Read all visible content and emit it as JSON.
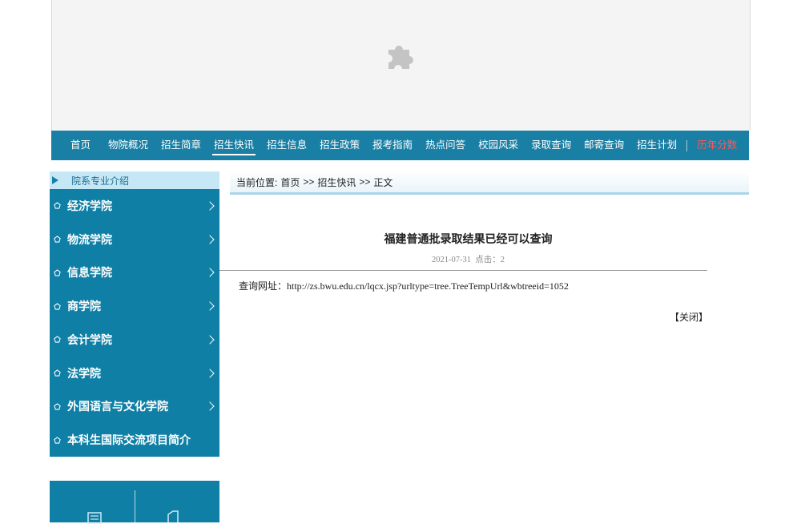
{
  "nav": {
    "items": [
      "首页",
      "物院概况",
      "招生简章",
      "招生快讯",
      "招生信息",
      "招生政策",
      "报考指南",
      "热点问答",
      "校园风采",
      "录取查询",
      "邮寄查询",
      "招生计划"
    ],
    "active_index": 3,
    "extra": "历年分数",
    "colors": {
      "bar": "#1a7fa4",
      "extra_text": "#ff5a5a"
    }
  },
  "sidebar": {
    "heading": "院系专业介绍",
    "items": [
      {
        "label": "经济学院"
      },
      {
        "label": "物流学院"
      },
      {
        "label": "信息学院"
      },
      {
        "label": "商学院"
      },
      {
        "label": "会计学院"
      },
      {
        "label": "法学院"
      },
      {
        "label": "外国语言与文化学院"
      },
      {
        "label": "本科生国际交流项目简介"
      }
    ]
  },
  "breadcrumb": {
    "prefix": "当前位置:",
    "items": [
      "首页",
      "招生快讯",
      "正文"
    ],
    "separator": ">>"
  },
  "article": {
    "title": "福建普通批录取结果已经可以查询",
    "date": "2021-07-31",
    "hits_label": "点击：",
    "hits": "2",
    "body_label": "查询网址：",
    "body_url": "http://zs.bwu.edu.cn/lqcx.jsp?urltype=tree.TreeTempUrl&wbtreeid=1052",
    "close_label": "【关闭】"
  }
}
